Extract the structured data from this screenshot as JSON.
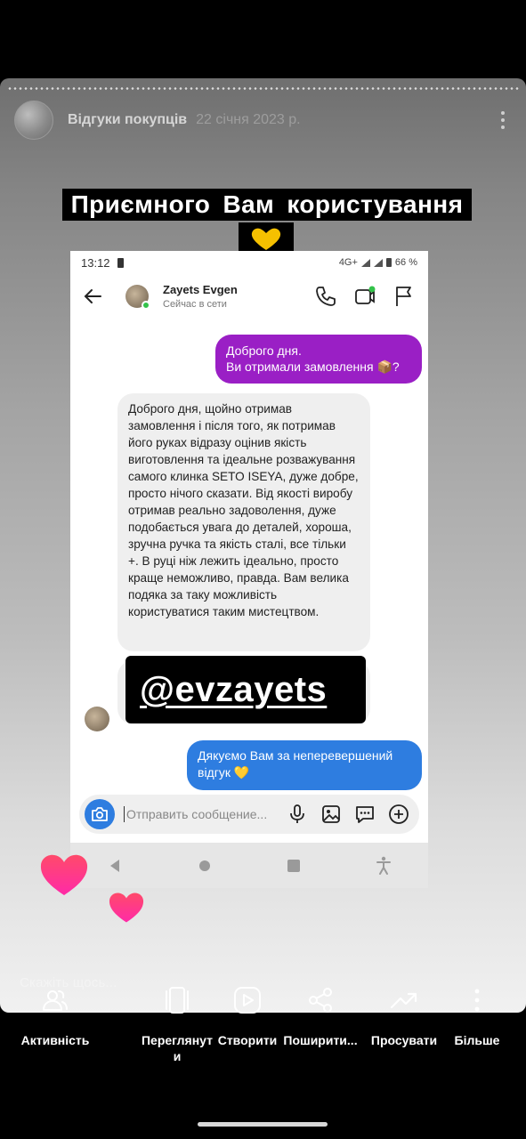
{
  "story": {
    "account_name": "Відгуки покупців",
    "date": "22 січня 2023 р.",
    "avatar_icon": "account-avatar",
    "more_icon": "vertical-dots-icon",
    "overlay_title": "Приємного Вам користування",
    "overlay_emoji": "yellow-heart-icon"
  },
  "chat": {
    "status_bar": {
      "time": "13:12",
      "network": "4G+",
      "battery": "66 %"
    },
    "contact": {
      "name": "Zayets Evgen",
      "status": "Сейчас в сети"
    },
    "messages": {
      "out_1": "Доброго дня.\nВи отримали замовлення 📦?",
      "in_1": "Доброго дня, щойно отримав замовлення і після того, як потримав його руках відразу оцінив якість виготовлення та ідеальне розважування самого клинка SETO ISEYA, дуже добре, просто нічого сказати. Від якості виробу отримав реально задоволення, дуже подобається увага до деталей, хороша, зручна ручка та якість сталі, все тільки +. В руці ніж лежить ідеально, просто краще неможливо, правда. Вам велика подяка за таку можливість користуватися таким мистецтвом.",
      "out_2": "Дякуємо Вам за неперевершений відгук 💛"
    },
    "mention_sticker": "@evzayets",
    "composer_placeholder": "Отправить сообщение..."
  },
  "say_something": "Скажіть щось...",
  "actions": [
    {
      "label": "Активність",
      "icon": "activity-people-icon"
    },
    {
      "label": "Переглянут\nи",
      "icon": "view-cards-icon"
    },
    {
      "label": "Створити",
      "icon": "create-video-icon"
    },
    {
      "label": "Поширити...",
      "icon": "share-icon"
    },
    {
      "label": "Просувати",
      "icon": "promote-trend-icon"
    },
    {
      "label": "Більше",
      "icon": "more-vertical-icon"
    }
  ],
  "colors": {
    "outgoing_purple": "#9a1fc5",
    "outgoing_blue": "#2e7de0",
    "incoming_gray": "#efefef",
    "heart_pink": "#ff2e84"
  }
}
